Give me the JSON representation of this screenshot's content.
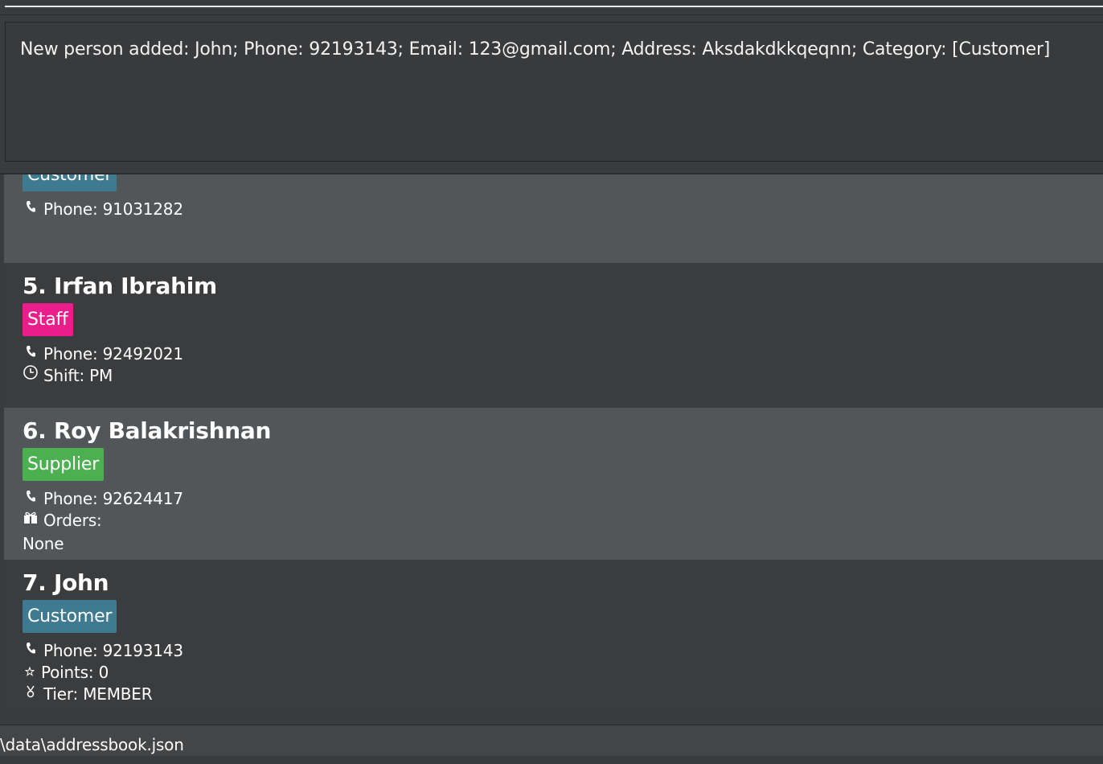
{
  "result": {
    "message": "New person added: John; Phone: 92193143; Email: 123@gmail.com; Address: Aksdakdkkqeqnn; Category: [Customer]"
  },
  "cards": {
    "c4": {
      "category": "Customer",
      "category_color": "#3e7b91",
      "phone": "Phone: 91031282"
    },
    "c5": {
      "name": "5. Irfan Ibrahim",
      "category": "Staff",
      "category_color": "#e91e8a",
      "phone": "Phone: 92492021",
      "shift": "Shift: PM"
    },
    "c6": {
      "name": "6. Roy Balakrishnan",
      "category": "Supplier",
      "category_color": "#4caf50",
      "phone": "Phone: 92624417",
      "orders": "Orders:",
      "orders_value": "None"
    },
    "c7": {
      "name": "7. John",
      "category": "Customer",
      "category_color": "#3e7b91",
      "phone": "Phone: 92193143",
      "points": "Points: 0",
      "tier": "Tier: MEMBER"
    }
  },
  "icons": {
    "phone": "phone-icon",
    "clock": "clock-icon",
    "gift": "gift-icon",
    "star": "star-icon",
    "medal": "medal-icon"
  },
  "status": {
    "path": "\\data\\addressbook.json"
  }
}
